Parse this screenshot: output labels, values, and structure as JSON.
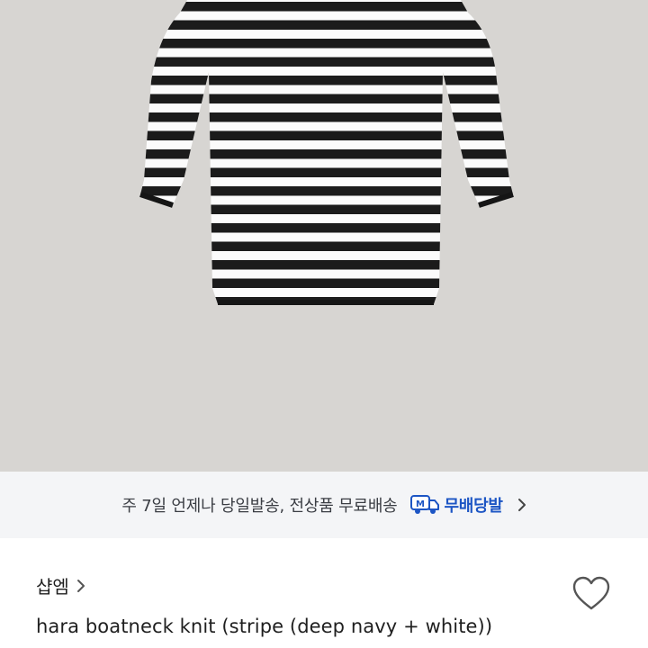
{
  "product_image": {
    "alt": "hara boatneck knit",
    "background_color": "#d7d5d2",
    "stripe_colors": [
      "#1b1b1b",
      "#fbfbfb"
    ]
  },
  "shipping_banner": {
    "text": "주 7일 언제나 당일발송, 전상품 무료배송",
    "badge_icon": "delivery-truck-m-icon",
    "badge_label": "무배당발",
    "badge_color": "#1c55c4",
    "chevron_icon": "chevron-right-icon"
  },
  "seller": {
    "name": "샵엠",
    "chevron_icon": "chevron-right-icon"
  },
  "favorite": {
    "icon": "heart-outline-icon"
  },
  "product": {
    "title": "hara boatneck knit (stripe (deep navy + white))"
  }
}
